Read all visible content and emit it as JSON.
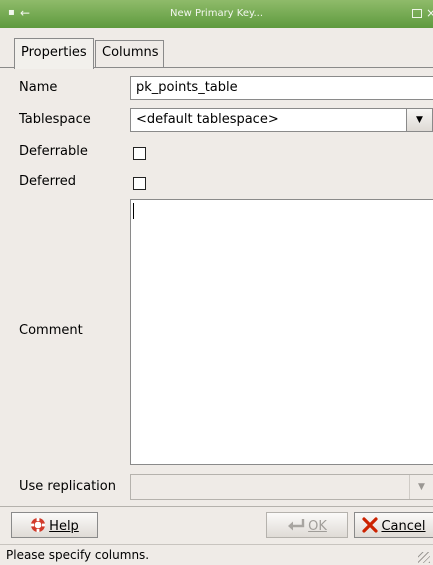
{
  "window": {
    "title": "New Primary Key..."
  },
  "tabs": [
    {
      "label": "Properties"
    },
    {
      "label": "Columns"
    }
  ],
  "form": {
    "name_label": "Name",
    "name_value": "pk_points_table",
    "tablespace_label": "Tablespace",
    "tablespace_value": "<default tablespace>",
    "deferrable_label": "Deferrable",
    "deferrable_checked": false,
    "deferred_label": "Deferred",
    "deferred_checked": false,
    "comment_label": "Comment",
    "comment_value": "",
    "replication_label": "Use replication",
    "replication_value": ""
  },
  "buttons": {
    "help": "Help",
    "ok": "OK",
    "cancel": "Cancel"
  },
  "status": {
    "text": "Please specify columns."
  },
  "colors": {
    "titlebar": "#6fa84e",
    "background": "#efebe7",
    "cancel_icon": "#cc2200"
  },
  "icons": [
    "menu-dot-icon",
    "back-arrow-icon",
    "maximize-icon",
    "close-icon",
    "dropdown-arrow-icon",
    "help-icon",
    "ok-icon",
    "cancel-icon",
    "resize-grip-icon"
  ]
}
